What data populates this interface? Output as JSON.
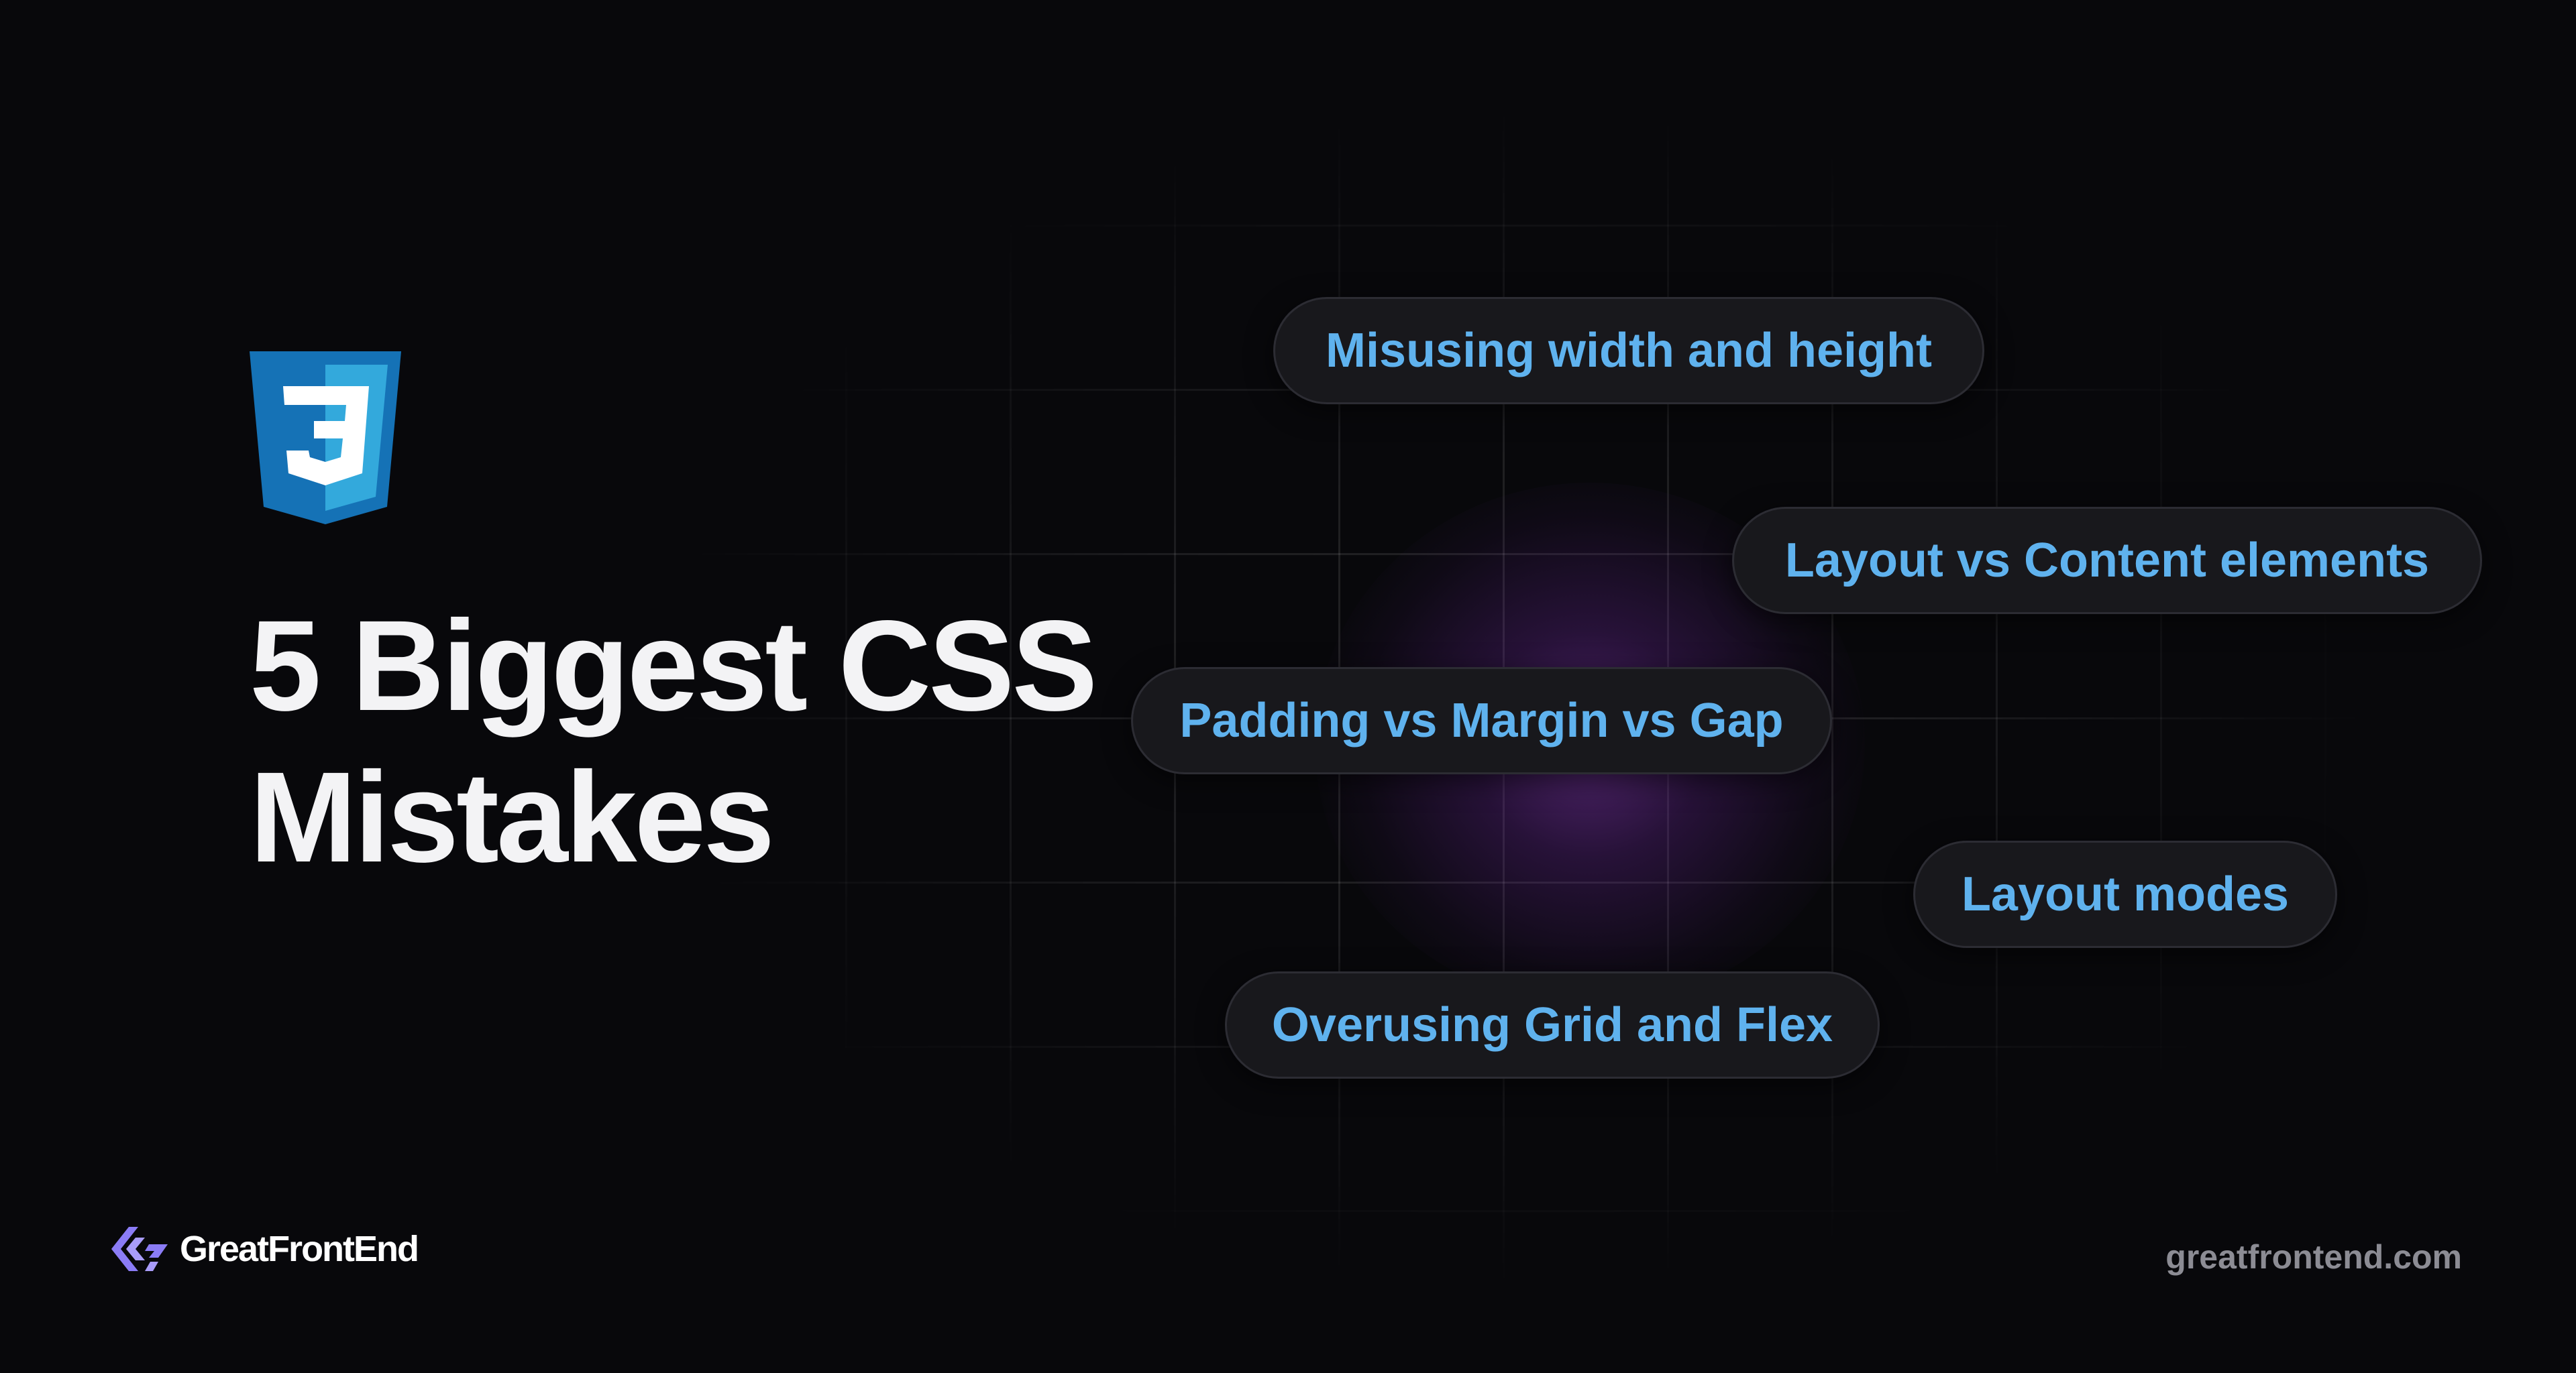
{
  "title": {
    "line1": "5 Biggest CSS",
    "line2": "Mistakes"
  },
  "pills": [
    {
      "label": "Misusing width and height"
    },
    {
      "label": "Layout vs Content elements"
    },
    {
      "label": "Padding vs Margin vs Gap"
    },
    {
      "label": "Layout modes"
    },
    {
      "label": "Overusing Grid and Flex"
    }
  ],
  "logo": {
    "icon": "css3-shield-icon",
    "number": "3"
  },
  "brand": {
    "name": "GreatFrontEnd",
    "icon": "greatfrontend-logo-icon"
  },
  "site_url": "greatfrontend.com",
  "colors": {
    "background": "#08080b",
    "pill_text": "#5fb2ee",
    "pill_bg": "#18181c",
    "title_text": "#f3f3f5",
    "css_blue": "#1572b6",
    "css_blue_light": "#33a9dc",
    "brand_purple": "#8b7cf6",
    "glow": "#8c3cbe",
    "url_text": "#8c8c94"
  }
}
